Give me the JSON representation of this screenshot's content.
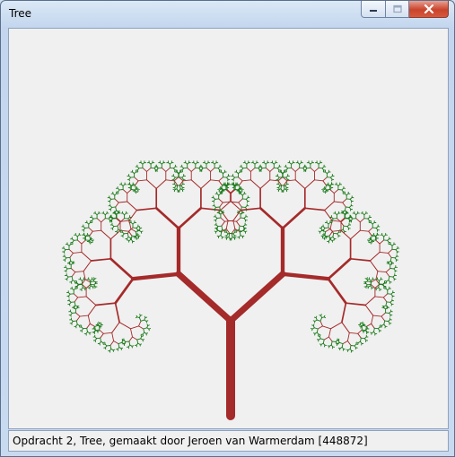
{
  "window": {
    "title": "Tree",
    "controls": [
      "minimize-icon",
      "maximize-icon",
      "close-icon"
    ]
  },
  "status": {
    "text": "Opdracht 2, Tree, gemaakt door Jeroen van Warmerdam [448872]"
  },
  "colors": {
    "trunk": "#a52a2a",
    "leaves": "#1a7a1a",
    "canvas": "#f0f0f0"
  }
}
